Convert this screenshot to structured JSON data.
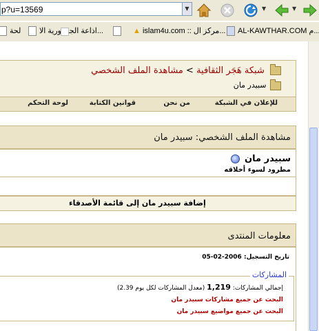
{
  "browser": {
    "address_value": "p?u=13569",
    "bookmarks": [
      "AL-KAWTHAR.COM م...",
      "islam4u.com :: مركز ال...",
      "اذاعة الجمهورية الا...",
      "لحة"
    ]
  },
  "breadcrumb": {
    "site": "شبكة هَجَر الثقافية",
    "separator": ">",
    "current": "مشاهدة الملف الشخصي",
    "sub": "سبيدر مان"
  },
  "nav": {
    "items": [
      "للإعلان في الشبكة",
      "من نحن",
      "قوانين الكتابة",
      "لوحة التحكم"
    ]
  },
  "profile": {
    "heading": "مشاهدة الملف الشخصي: سبيدر مان",
    "username": "سبيدر مان",
    "user_title": "مطرود لسوء أخلاقه",
    "add_friend": "إضافة سبيدر مان إلى قائمة الأصدقاء"
  },
  "forum_info": {
    "heading": "معلومات المنتدى",
    "reg_label": "تاريخ التسجيل:",
    "reg_date": "2006-02-05",
    "posts_legend": "المشاركات",
    "total_label": "إجمالي المشاركات:",
    "total_value": "1,219",
    "per_day": "(معدل المشاركات لكل يوم 2.39)",
    "link_posts": "البحث عن جميع مشاركات سبيدر مان",
    "link_threads": "البحث عن جميع مواضيع سبيدر مان"
  }
}
